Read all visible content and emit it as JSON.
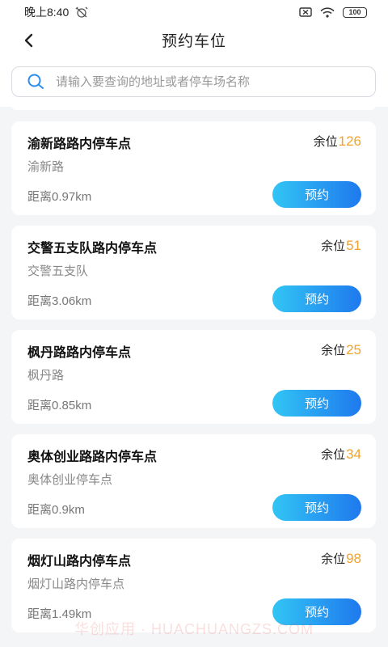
{
  "status_bar": {
    "time": "晚上8:40",
    "battery": "100"
  },
  "header": {
    "title": "预约车位"
  },
  "search": {
    "placeholder": "请输入要查询的地址或者停车场名称"
  },
  "remain_label": "余位",
  "reserve_label": "预约",
  "parking_list": [
    {
      "name": "渝新路路内停车点",
      "address": "渝新路",
      "distance": "距离0.97km",
      "remaining": "126"
    },
    {
      "name": "交警五支队路内停车点",
      "address": "交警五支队",
      "distance": "距离3.06km",
      "remaining": "51"
    },
    {
      "name": "枫丹路路内停车点",
      "address": "枫丹路",
      "distance": "距离0.85km",
      "remaining": "25"
    },
    {
      "name": "奥体创业路路内停车点",
      "address": "奥体创业停车点",
      "distance": "距离0.9km",
      "remaining": "34"
    },
    {
      "name": "烟灯山路内停车点",
      "address": "烟灯山路内停车点",
      "distance": "距离1.49km",
      "remaining": "98"
    }
  ],
  "watermark": "华创应用 · HUACHUANGZS.COM",
  "colors": {
    "accent_orange": "#f0a32b",
    "button_gradient_start": "#32c5f4",
    "button_gradient_end": "#1f79ee"
  }
}
